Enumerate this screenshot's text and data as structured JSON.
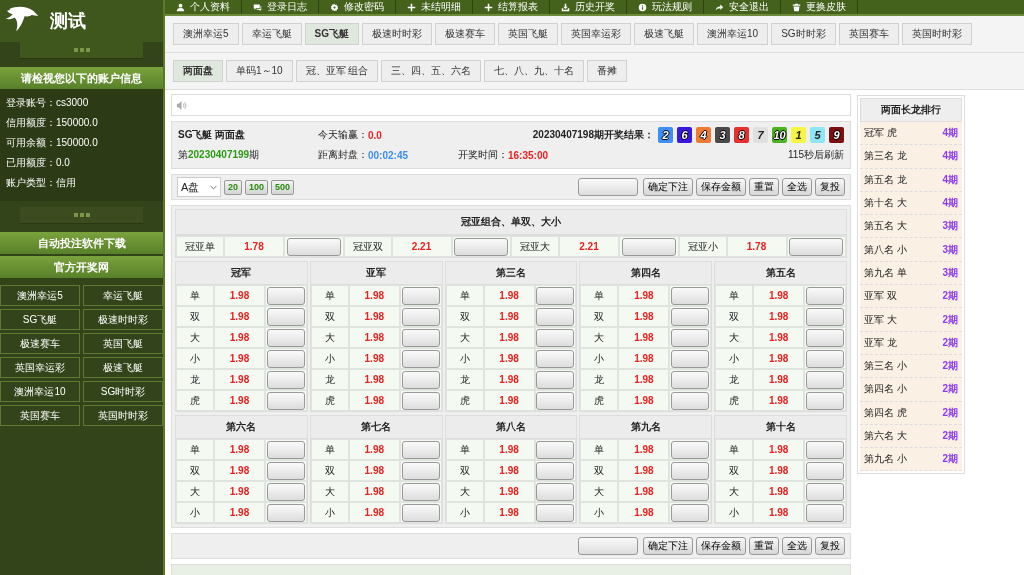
{
  "sidebar": {
    "logo_text": "测试",
    "account_header": "请检视您以下的账户信息",
    "account_fields": [
      {
        "label": "登录账号：",
        "value": "cs3000"
      },
      {
        "label": "信用额度：",
        "value": "150000.0"
      },
      {
        "label": "可用余额：",
        "value": "150000.0"
      },
      {
        "label": "已用额度：",
        "value": "0.0"
      },
      {
        "label": "账户类型：",
        "value": "信用"
      }
    ],
    "download_button": "自动投注软件下载",
    "official_header": "官方开奖网",
    "official_links": [
      "澳洲幸运5",
      "幸运飞艇",
      "SG飞艇",
      "极速时时彩",
      "极速赛车",
      "英国飞艇",
      "英国幸运彩",
      "极速飞艇",
      "澳洲幸运10",
      "SG时时彩",
      "英国赛车",
      "英国时时彩"
    ]
  },
  "nav": [
    "个人资料",
    "登录日志",
    "修改密码",
    "未结明细",
    "结算报表",
    "历史开奖",
    "玩法规则",
    "安全退出",
    "更换皮肤"
  ],
  "game_tabs": [
    {
      "label": "澳洲幸运5",
      "selected": false
    },
    {
      "label": "幸运飞艇",
      "selected": false
    },
    {
      "label": "SG飞艇",
      "selected": true
    },
    {
      "label": "极速时时彩",
      "selected": false
    },
    {
      "label": "极速赛车",
      "selected": false
    },
    {
      "label": "英国飞艇",
      "selected": false
    },
    {
      "label": "英国幸运彩",
      "selected": false
    },
    {
      "label": "极速飞艇",
      "selected": false
    },
    {
      "label": "澳洲幸运10",
      "selected": false
    },
    {
      "label": "SG时时彩",
      "selected": false
    },
    {
      "label": "英国赛车",
      "selected": false
    },
    {
      "label": "英国时时彩",
      "selected": false
    }
  ],
  "play_tabs": [
    {
      "label": "两面盘",
      "selected": true
    },
    {
      "label": "单码1～10",
      "selected": false
    },
    {
      "label": "冠、亚军 组合",
      "selected": false
    },
    {
      "label": "三、四、五、六名",
      "selected": false
    },
    {
      "label": "七、八、九、十名",
      "selected": false
    },
    {
      "label": "番摊",
      "selected": false
    }
  ],
  "info": {
    "title": "SG飞艇 两面盘",
    "today_label": "今天输赢：",
    "today_value": "0.0",
    "result_label": "20230407198期开奖结果：",
    "balls": [
      {
        "number": "2",
        "color": "#3d8ef5"
      },
      {
        "number": "6",
        "color": "#3a17e0"
      },
      {
        "number": "4",
        "color": "#f07a30"
      },
      {
        "number": "3",
        "color": "#4a4a4a"
      },
      {
        "number": "8",
        "color": "#e53030"
      },
      {
        "number": "7",
        "color": "#e0e0e0"
      },
      {
        "number": "10",
        "color": "#4bb320"
      },
      {
        "number": "1",
        "color": "#f5f542"
      },
      {
        "number": "5",
        "color": "#8fe5f5"
      },
      {
        "number": "9",
        "color": "#7a1010"
      }
    ],
    "issue_prefix": "第",
    "issue_number": "20230407199",
    "issue_suffix": "期",
    "close_label": "距离封盘：",
    "close_value": "00:02:45",
    "draw_label": "开奖时间：",
    "draw_value": "16:35:00",
    "refresh": "115秒后刷新"
  },
  "toolbar": {
    "plate": "A盘",
    "quick_amounts": [
      "20",
      "100",
      "500"
    ],
    "buttons": [
      "确定下注",
      "保存金额",
      "重置",
      "全选",
      "复投"
    ]
  },
  "combo": {
    "title": "冠亚组合、单双、大小",
    "items": [
      {
        "label": "冠亚单",
        "odds": "1.78"
      },
      {
        "label": "冠亚双",
        "odds": "2.21"
      },
      {
        "label": "冠亚大",
        "odds": "2.21"
      },
      {
        "label": "冠亚小",
        "odds": "1.78"
      }
    ]
  },
  "positions": [
    {
      "name": "冠军",
      "rows": [
        {
          "label": "单",
          "odds": "1.98"
        },
        {
          "label": "双",
          "odds": "1.98"
        },
        {
          "label": "大",
          "odds": "1.98"
        },
        {
          "label": "小",
          "odds": "1.98"
        },
        {
          "label": "龙",
          "odds": "1.98"
        },
        {
          "label": "虎",
          "odds": "1.98"
        }
      ]
    },
    {
      "name": "亚军",
      "rows": [
        {
          "label": "单",
          "odds": "1.98"
        },
        {
          "label": "双",
          "odds": "1.98"
        },
        {
          "label": "大",
          "odds": "1.98"
        },
        {
          "label": "小",
          "odds": "1.98"
        },
        {
          "label": "龙",
          "odds": "1.98"
        },
        {
          "label": "虎",
          "odds": "1.98"
        }
      ]
    },
    {
      "name": "第三名",
      "rows": [
        {
          "label": "单",
          "odds": "1.98"
        },
        {
          "label": "双",
          "odds": "1.98"
        },
        {
          "label": "大",
          "odds": "1.98"
        },
        {
          "label": "小",
          "odds": "1.98"
        },
        {
          "label": "龙",
          "odds": "1.98"
        },
        {
          "label": "虎",
          "odds": "1.98"
        }
      ]
    },
    {
      "name": "第四名",
      "rows": [
        {
          "label": "单",
          "odds": "1.98"
        },
        {
          "label": "双",
          "odds": "1.98"
        },
        {
          "label": "大",
          "odds": "1.98"
        },
        {
          "label": "小",
          "odds": "1.98"
        },
        {
          "label": "龙",
          "odds": "1.98"
        },
        {
          "label": "虎",
          "odds": "1.98"
        }
      ]
    },
    {
      "name": "第五名",
      "rows": [
        {
          "label": "单",
          "odds": "1.98"
        },
        {
          "label": "双",
          "odds": "1.98"
        },
        {
          "label": "大",
          "odds": "1.98"
        },
        {
          "label": "小",
          "odds": "1.98"
        },
        {
          "label": "龙",
          "odds": "1.98"
        },
        {
          "label": "虎",
          "odds": "1.98"
        }
      ]
    },
    {
      "name": "第六名",
      "rows": [
        {
          "label": "单",
          "odds": "1.98"
        },
        {
          "label": "双",
          "odds": "1.98"
        },
        {
          "label": "大",
          "odds": "1.98"
        },
        {
          "label": "小",
          "odds": "1.98"
        }
      ]
    },
    {
      "name": "第七名",
      "rows": [
        {
          "label": "单",
          "odds": "1.98"
        },
        {
          "label": "双",
          "odds": "1.98"
        },
        {
          "label": "大",
          "odds": "1.98"
        },
        {
          "label": "小",
          "odds": "1.98"
        }
      ]
    },
    {
      "name": "第八名",
      "rows": [
        {
          "label": "单",
          "odds": "1.98"
        },
        {
          "label": "双",
          "odds": "1.98"
        },
        {
          "label": "大",
          "odds": "1.98"
        },
        {
          "label": "小",
          "odds": "1.98"
        }
      ]
    },
    {
      "name": "第九名",
      "rows": [
        {
          "label": "单",
          "odds": "1.98"
        },
        {
          "label": "双",
          "odds": "1.98"
        },
        {
          "label": "大",
          "odds": "1.98"
        },
        {
          "label": "小",
          "odds": "1.98"
        }
      ]
    },
    {
      "name": "第十名",
      "rows": [
        {
          "label": "单",
          "odds": "1.98"
        },
        {
          "label": "双",
          "odds": "1.98"
        },
        {
          "label": "大",
          "odds": "1.98"
        },
        {
          "label": "小",
          "odds": "1.98"
        }
      ]
    }
  ],
  "bottom_toolbar": {
    "buttons": [
      "确定下注",
      "保存金额",
      "重置",
      "全选",
      "复投"
    ]
  },
  "long_dragon": {
    "title": "两面长龙排行",
    "items": [
      {
        "label": "冠军 虎",
        "count": "4期"
      },
      {
        "label": "第三名 龙",
        "count": "4期"
      },
      {
        "label": "第五名 龙",
        "count": "4期"
      },
      {
        "label": "第十名 大",
        "count": "4期"
      },
      {
        "label": "第五名 大",
        "count": "3期"
      },
      {
        "label": "第八名 小",
        "count": "3期"
      },
      {
        "label": "第九名 单",
        "count": "3期"
      },
      {
        "label": "亚军 双",
        "count": "2期"
      },
      {
        "label": "亚军 大",
        "count": "2期"
      },
      {
        "label": "亚军 龙",
        "count": "2期"
      },
      {
        "label": "第三名 小",
        "count": "2期"
      },
      {
        "label": "第四名 小",
        "count": "2期"
      },
      {
        "label": "第四名 虎",
        "count": "2期"
      },
      {
        "label": "第六名 大",
        "count": "2期"
      },
      {
        "label": "第九名 小",
        "count": "2期"
      }
    ]
  }
}
